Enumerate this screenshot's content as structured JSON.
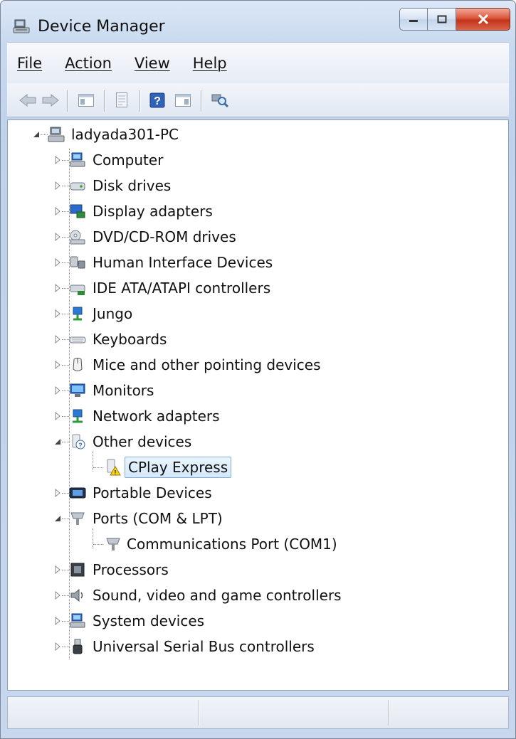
{
  "window": {
    "title": "Device Manager"
  },
  "menu": [
    {
      "label": "File"
    },
    {
      "label": "Action"
    },
    {
      "label": "View"
    },
    {
      "label": "Help"
    }
  ],
  "toolbar": [
    {
      "icon": "back-icon"
    },
    {
      "icon": "forward-icon"
    },
    {
      "icon": "show-hide-console-tree-icon"
    },
    {
      "icon": "properties-icon"
    },
    {
      "icon": "help-icon"
    },
    {
      "icon": "show-hide-action-pane-icon"
    },
    {
      "icon": "scan-hardware-changes-icon"
    }
  ],
  "tree": {
    "root": {
      "label": "ladyada301-PC",
      "icon": "computer-icon",
      "expanded": true
    },
    "categories": [
      {
        "label": "Computer",
        "icon": "computer-icon",
        "expanded": false
      },
      {
        "label": "Disk drives",
        "icon": "disk-drive-icon",
        "expanded": false
      },
      {
        "label": "Display adapters",
        "icon": "display-adapter-icon",
        "expanded": false
      },
      {
        "label": "DVD/CD-ROM drives",
        "icon": "dvd-drive-icon",
        "expanded": false
      },
      {
        "label": "Human Interface Devices",
        "icon": "hid-icon",
        "expanded": false
      },
      {
        "label": "IDE ATA/ATAPI controllers",
        "icon": "ide-controller-icon",
        "expanded": false
      },
      {
        "label": "Jungo",
        "icon": "jungo-icon",
        "expanded": false
      },
      {
        "label": "Keyboards",
        "icon": "keyboard-icon",
        "expanded": false
      },
      {
        "label": "Mice and other pointing devices",
        "icon": "mouse-icon",
        "expanded": false
      },
      {
        "label": "Monitors",
        "icon": "monitor-icon",
        "expanded": false
      },
      {
        "label": "Network adapters",
        "icon": "network-adapter-icon",
        "expanded": false
      },
      {
        "label": "Other devices",
        "icon": "unknown-device-icon",
        "expanded": true,
        "children": [
          {
            "label": "CPlay Express",
            "icon": "unknown-device-warning-icon",
            "selected": true
          }
        ]
      },
      {
        "label": "Portable Devices",
        "icon": "portable-device-icon",
        "expanded": false
      },
      {
        "label": "Ports (COM & LPT)",
        "icon": "port-icon",
        "expanded": true,
        "children": [
          {
            "label": "Communications Port (COM1)",
            "icon": "port-icon"
          }
        ]
      },
      {
        "label": "Processors",
        "icon": "processor-icon",
        "expanded": false
      },
      {
        "label": "Sound, video and game controllers",
        "icon": "sound-icon",
        "expanded": false
      },
      {
        "label": "System devices",
        "icon": "system-device-icon",
        "expanded": false
      },
      {
        "label": "Universal Serial Bus controllers",
        "icon": "usb-icon",
        "expanded": false
      }
    ]
  },
  "statusbar": {
    "panes": [
      "",
      "",
      ""
    ]
  },
  "colors": {
    "accent": "#3a6ea5",
    "selection": "#d5e8fa",
    "close": "#c4331a"
  }
}
